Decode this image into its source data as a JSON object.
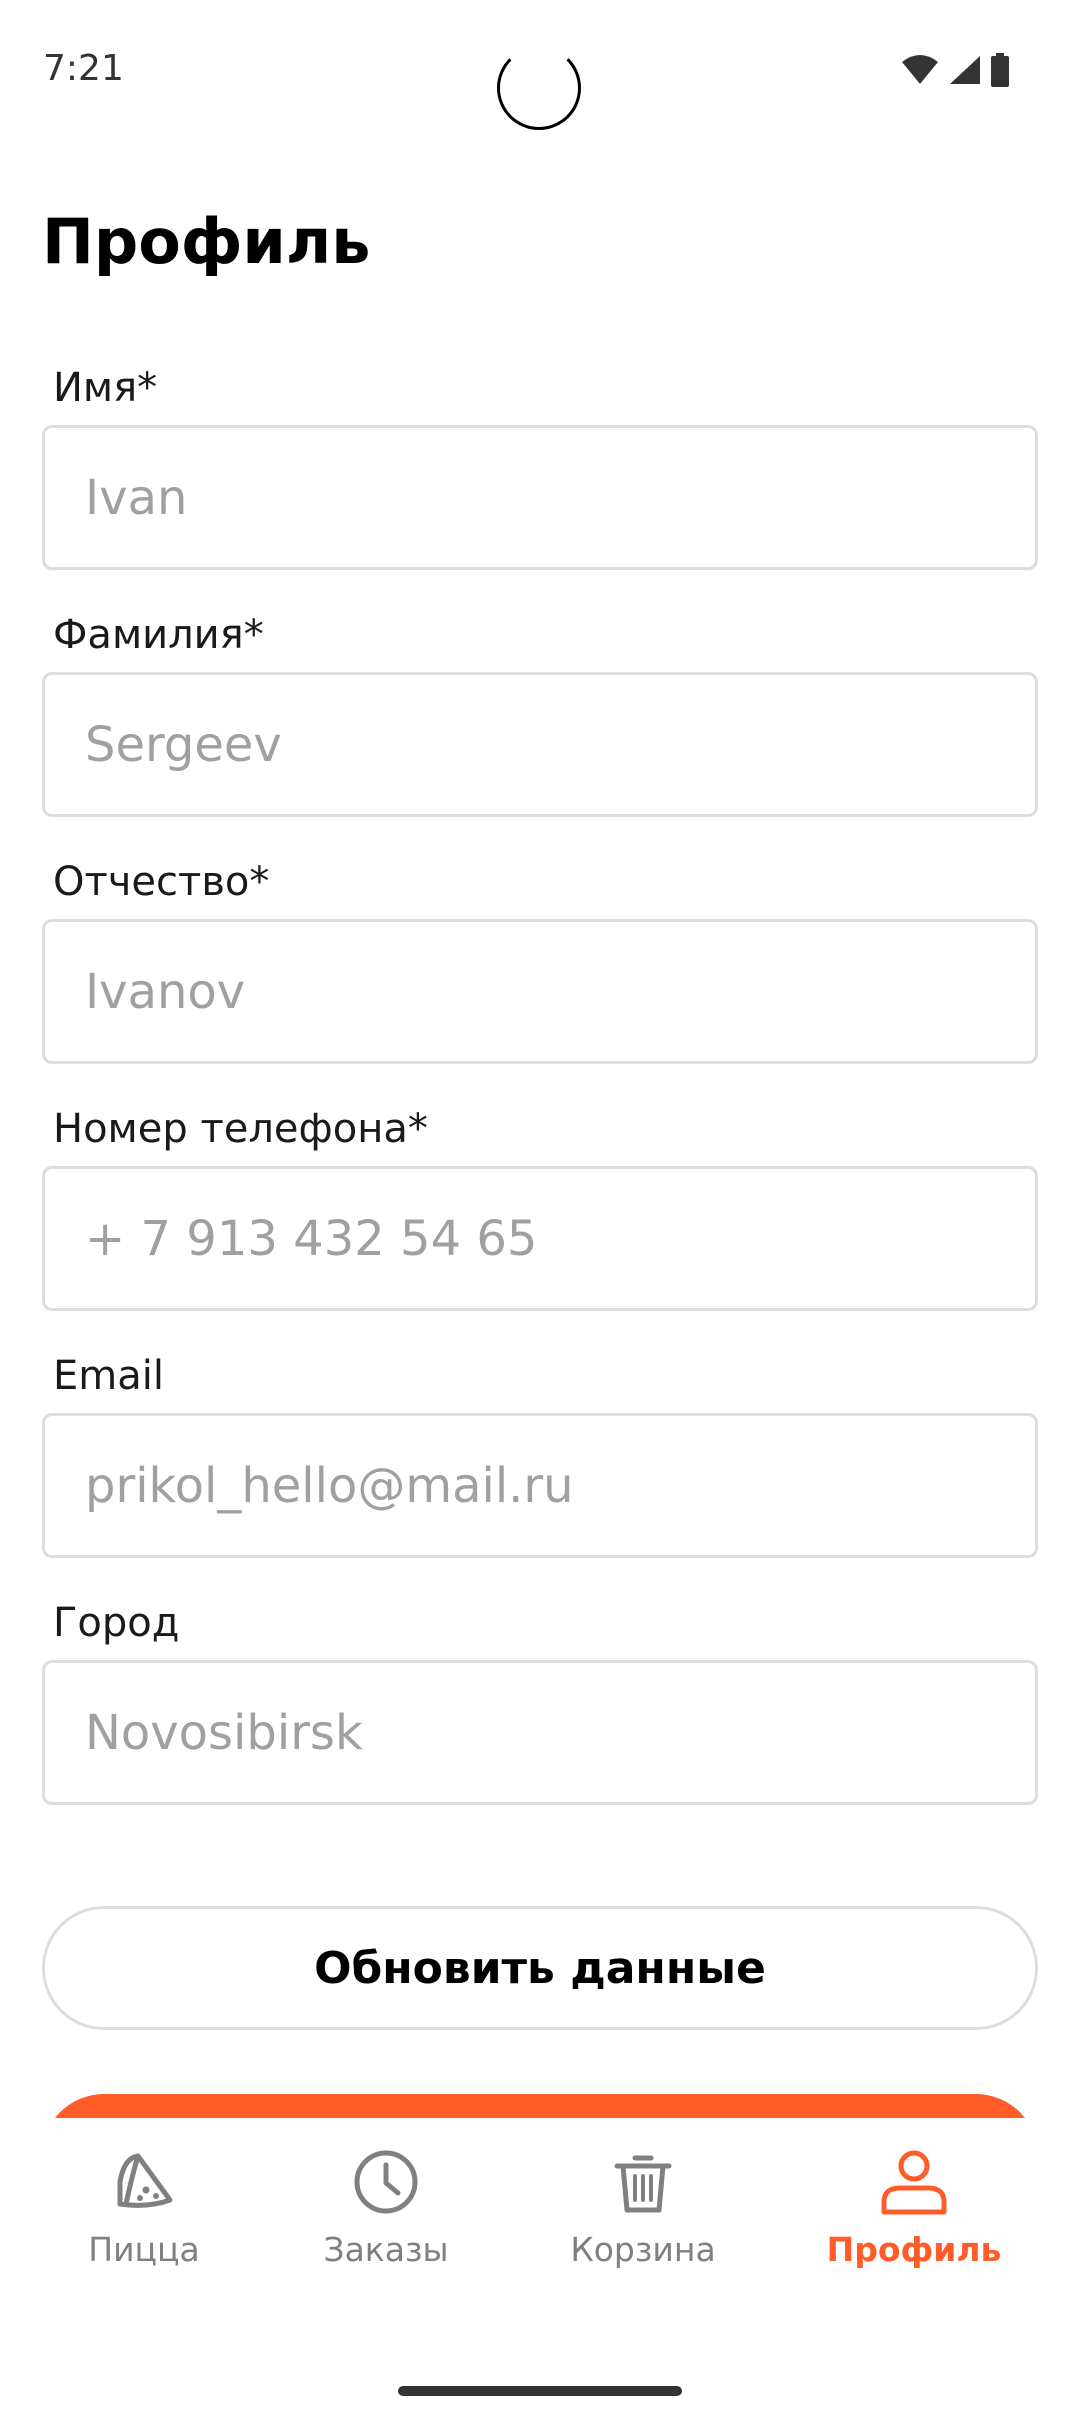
{
  "status_bar": {
    "time": "7:21"
  },
  "page": {
    "title": "Профиль"
  },
  "form": {
    "first_name": {
      "label": "Имя*",
      "placeholder": "Ivan"
    },
    "last_name": {
      "label": "Фамилия*",
      "placeholder": "Sergeev"
    },
    "patronymic": {
      "label": "Отчество*",
      "placeholder": "Ivanov"
    },
    "phone": {
      "label": "Номер телефона*",
      "placeholder": "+ 7 913 432 54 65"
    },
    "email": {
      "label": "Email",
      "placeholder": "prikol_hello@mail.ru"
    },
    "city": {
      "label": "Город",
      "placeholder": "Novosibirsk"
    }
  },
  "actions": {
    "update_label": "Обновить данные"
  },
  "nav": {
    "items": [
      {
        "label": "Пицца",
        "icon": "pizza-icon",
        "active": false
      },
      {
        "label": "Заказы",
        "icon": "clock-icon",
        "active": false
      },
      {
        "label": "Корзина",
        "icon": "trash-icon",
        "active": false
      },
      {
        "label": "Профиль",
        "icon": "person-icon",
        "active": true
      }
    ]
  },
  "colors": {
    "accent": "#ff5c28",
    "inactive": "#808080",
    "border": "#dddddd"
  }
}
